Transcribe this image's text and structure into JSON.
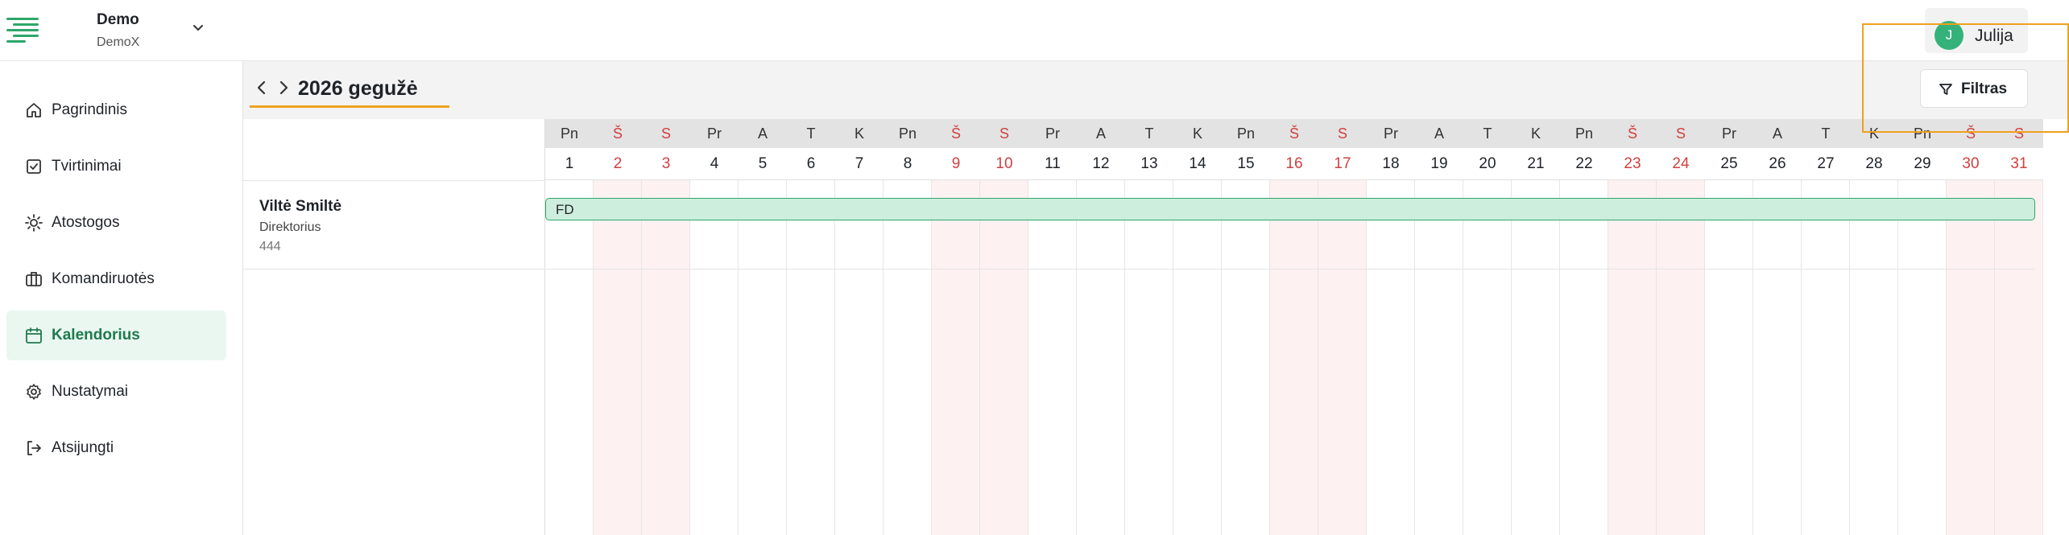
{
  "header": {
    "org_name": "Demo",
    "org_sub": "DemoX",
    "user_initial": "J",
    "user_name": "Julija",
    "colors": {
      "brand": "#2ea66b",
      "avatar": "#35b27a"
    }
  },
  "sidebar": {
    "items": [
      {
        "label": "Pagrindinis",
        "icon": "home-icon",
        "active": false
      },
      {
        "label": "Tvirtinimai",
        "icon": "checkbox-icon",
        "active": false
      },
      {
        "label": "Atostogos",
        "icon": "sun-icon",
        "active": false
      },
      {
        "label": "Komandiruotės",
        "icon": "briefcase-icon",
        "active": false
      },
      {
        "label": "Kalendorius",
        "icon": "calendar-icon",
        "active": true
      },
      {
        "label": "Nustatymai",
        "icon": "gear-icon",
        "active": false
      },
      {
        "label": "Atsijungti",
        "icon": "logout-icon",
        "active": false
      }
    ]
  },
  "toolbar": {
    "month_title": "2026 gegužė",
    "filter_label": "Filtras"
  },
  "calendar": {
    "days": [
      {
        "abbr": "Pn",
        "num": "1",
        "weekend": false
      },
      {
        "abbr": "Š",
        "num": "2",
        "weekend": true
      },
      {
        "abbr": "S",
        "num": "3",
        "weekend": true
      },
      {
        "abbr": "Pr",
        "num": "4",
        "weekend": false
      },
      {
        "abbr": "A",
        "num": "5",
        "weekend": false
      },
      {
        "abbr": "T",
        "num": "6",
        "weekend": false
      },
      {
        "abbr": "K",
        "num": "7",
        "weekend": false
      },
      {
        "abbr": "Pn",
        "num": "8",
        "weekend": false
      },
      {
        "abbr": "Š",
        "num": "9",
        "weekend": true
      },
      {
        "abbr": "S",
        "num": "10",
        "weekend": true
      },
      {
        "abbr": "Pr",
        "num": "11",
        "weekend": false
      },
      {
        "abbr": "A",
        "num": "12",
        "weekend": false
      },
      {
        "abbr": "T",
        "num": "13",
        "weekend": false
      },
      {
        "abbr": "K",
        "num": "14",
        "weekend": false
      },
      {
        "abbr": "Pn",
        "num": "15",
        "weekend": false
      },
      {
        "abbr": "Š",
        "num": "16",
        "weekend": true
      },
      {
        "abbr": "S",
        "num": "17",
        "weekend": true
      },
      {
        "abbr": "Pr",
        "num": "18",
        "weekend": false
      },
      {
        "abbr": "A",
        "num": "19",
        "weekend": false
      },
      {
        "abbr": "T",
        "num": "20",
        "weekend": false
      },
      {
        "abbr": "K",
        "num": "21",
        "weekend": false
      },
      {
        "abbr": "Pn",
        "num": "22",
        "weekend": false
      },
      {
        "abbr": "Š",
        "num": "23",
        "weekend": true
      },
      {
        "abbr": "S",
        "num": "24",
        "weekend": true
      },
      {
        "abbr": "Pr",
        "num": "25",
        "weekend": false
      },
      {
        "abbr": "A",
        "num": "26",
        "weekend": false
      },
      {
        "abbr": "T",
        "num": "27",
        "weekend": false
      },
      {
        "abbr": "K",
        "num": "28",
        "weekend": false
      },
      {
        "abbr": "Pn",
        "num": "29",
        "weekend": false
      },
      {
        "abbr": "Š",
        "num": "30",
        "weekend": true
      },
      {
        "abbr": "S",
        "num": "31",
        "weekend": true
      }
    ],
    "employee": {
      "name": "Viltė Smiltė",
      "role": "Direktorius",
      "code": "444"
    },
    "event": {
      "label": "FD",
      "colors": {
        "fill": "#cdeedd",
        "border": "#2ea66b"
      }
    },
    "colors": {
      "weekend_text": "#d04040",
      "weekend_fill": "#fdf1f1"
    }
  }
}
